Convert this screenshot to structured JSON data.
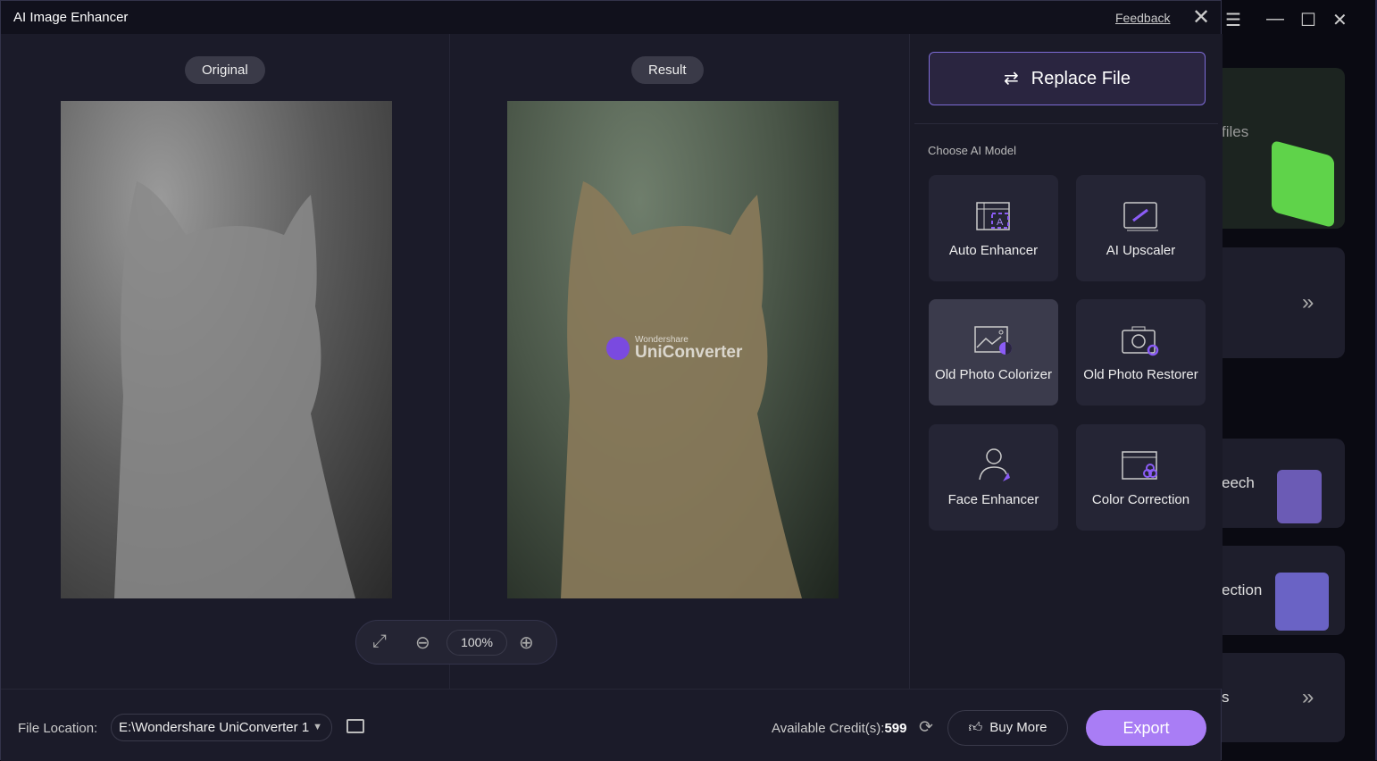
{
  "window": {
    "title": "AI Image Enhancer",
    "feedback": "Feedback"
  },
  "preview": {
    "original_label": "Original",
    "result_label": "Result",
    "zoom": "100%",
    "watermark": {
      "brand": "Wondershare",
      "product": "UniConverter"
    }
  },
  "panel": {
    "replace_file": "Replace File",
    "choose_label": "Choose AI Model",
    "selected": "Old Photo Colorizer",
    "models": [
      {
        "label": "Auto Enhancer",
        "icon": "auto-enhancer-icon"
      },
      {
        "label": "AI Upscaler",
        "icon": "upscaler-icon"
      },
      {
        "label": "Old Photo Colorizer",
        "icon": "colorizer-icon"
      },
      {
        "label": "Old Photo Restorer",
        "icon": "restorer-icon"
      },
      {
        "label": "Face Enhancer",
        "icon": "face-enhancer-icon"
      },
      {
        "label": "Color Correction",
        "icon": "color-correction-icon"
      }
    ]
  },
  "bottom": {
    "file_location_label": "File Location:",
    "file_location_value": "E:\\Wondershare UniConverter 1",
    "credits_label": "Available Credit(s):",
    "credits_value": "599",
    "buy_more": "Buy More",
    "export": "Export"
  },
  "background_app": {
    "card_texts": [
      "files",
      "eech",
      "ection",
      "s"
    ]
  },
  "colors": {
    "accent": "#a97df5",
    "background": "#1b1b29"
  }
}
